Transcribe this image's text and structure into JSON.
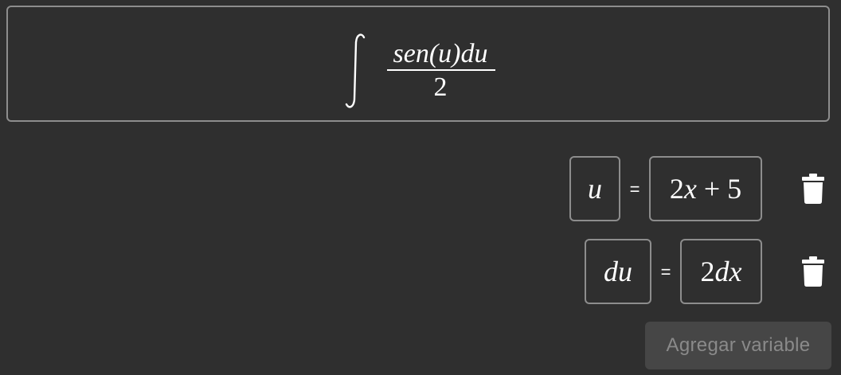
{
  "expression": {
    "integral_symbol": "∫",
    "numerator": "sen(u)du",
    "denominator": "2"
  },
  "variables": [
    {
      "name": "u",
      "equals": "=",
      "value_coef": "2",
      "value_var": "x",
      "value_rest": " + 5"
    },
    {
      "name": "du",
      "equals": "=",
      "value_coef": "2",
      "value_var": "dx",
      "value_rest": ""
    }
  ],
  "icons": {
    "delete": "trash-icon"
  },
  "add_button": {
    "label": "Agregar variable"
  },
  "colors": {
    "background": "#2f2f2f",
    "border": "#8d8d8d",
    "text": "#ffffff",
    "button_bg": "#464646",
    "button_text": "#8a8a8a"
  }
}
